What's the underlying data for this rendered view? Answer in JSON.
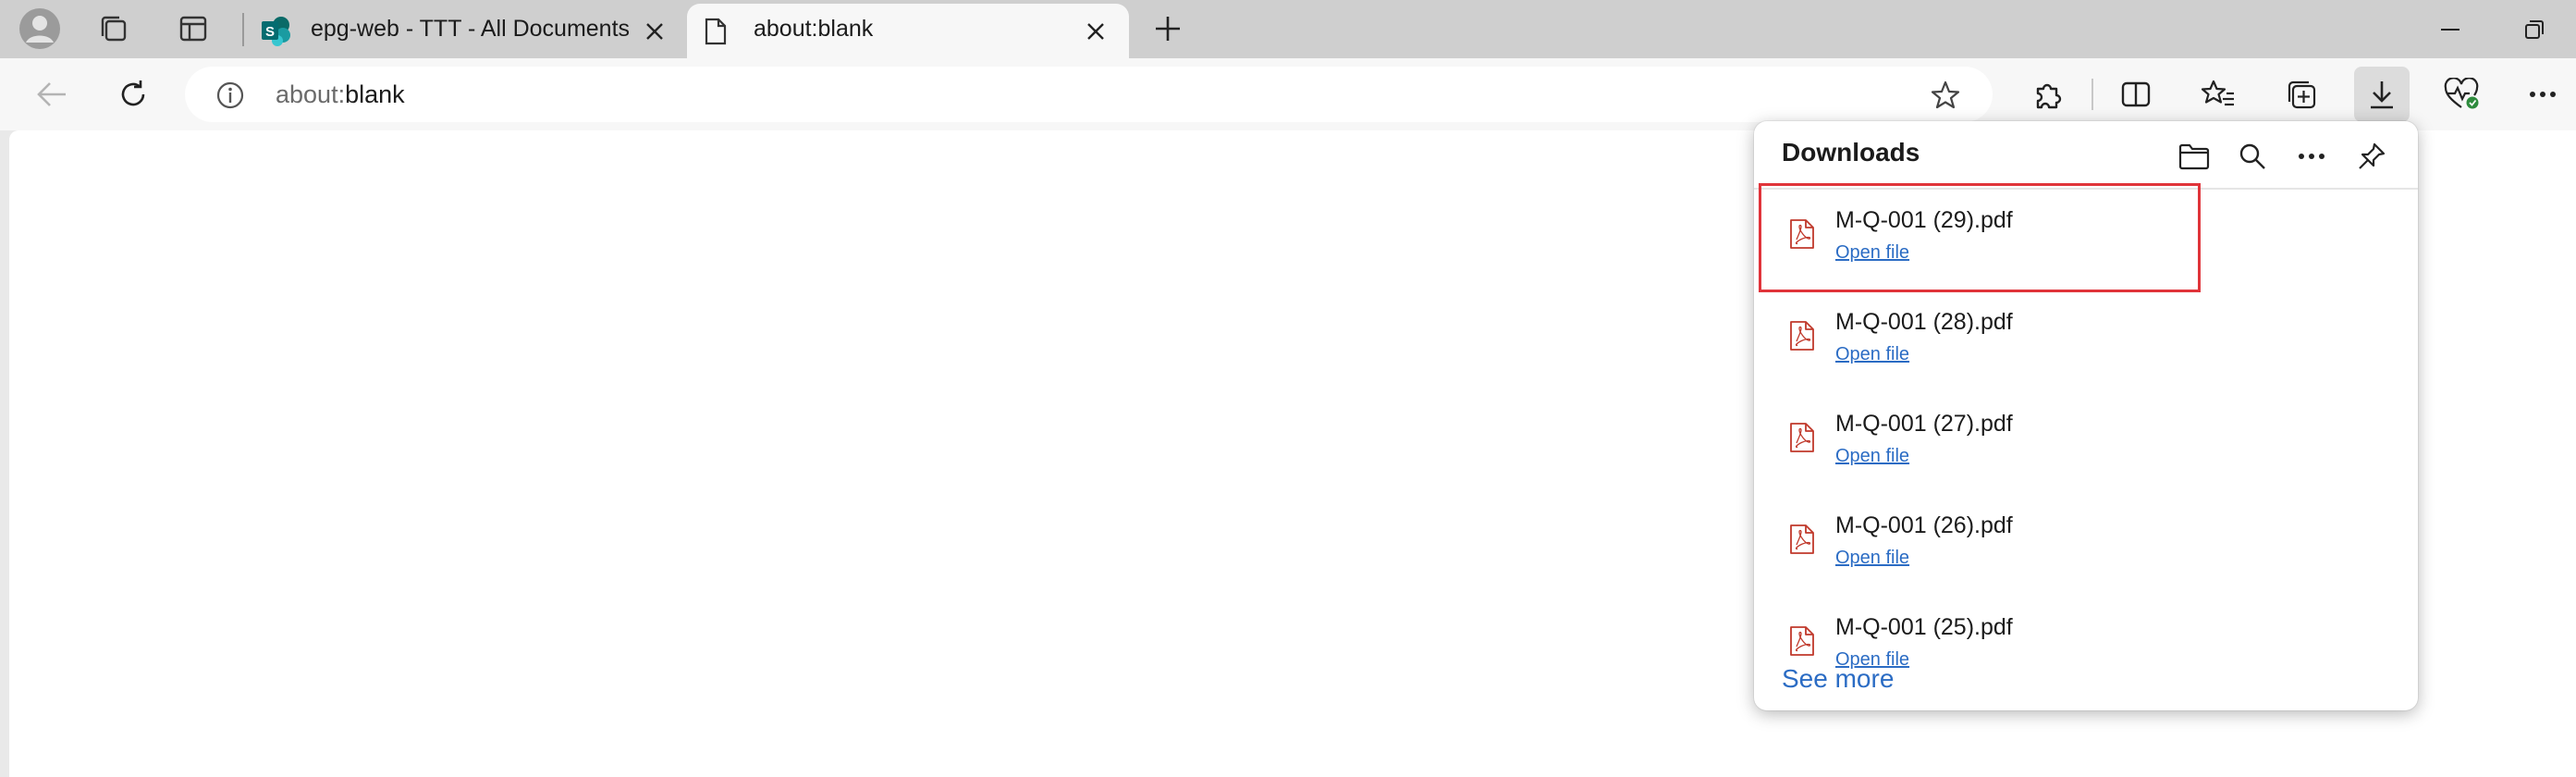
{
  "browser": {
    "tabs": [
      {
        "title": "epg-web - TTT - All Documents",
        "active": false,
        "favicon": "sharepoint-icon"
      },
      {
        "title": "about:blank",
        "active": true,
        "favicon": "page-icon"
      }
    ],
    "address": {
      "scheme": "about:",
      "rest": "blank"
    },
    "accent_color": "#2b6cc4"
  },
  "downloads": {
    "title": "Downloads",
    "items": [
      {
        "name": "M-Q-001 (29).pdf",
        "action": "Open file"
      },
      {
        "name": "M-Q-001 (28).pdf",
        "action": "Open file"
      },
      {
        "name": "M-Q-001 (27).pdf",
        "action": "Open file"
      },
      {
        "name": "M-Q-001 (26).pdf",
        "action": "Open file"
      },
      {
        "name": "M-Q-001 (25).pdf",
        "action": "Open file"
      }
    ],
    "see_more": "See more",
    "highlight_color": "#e0343a"
  }
}
